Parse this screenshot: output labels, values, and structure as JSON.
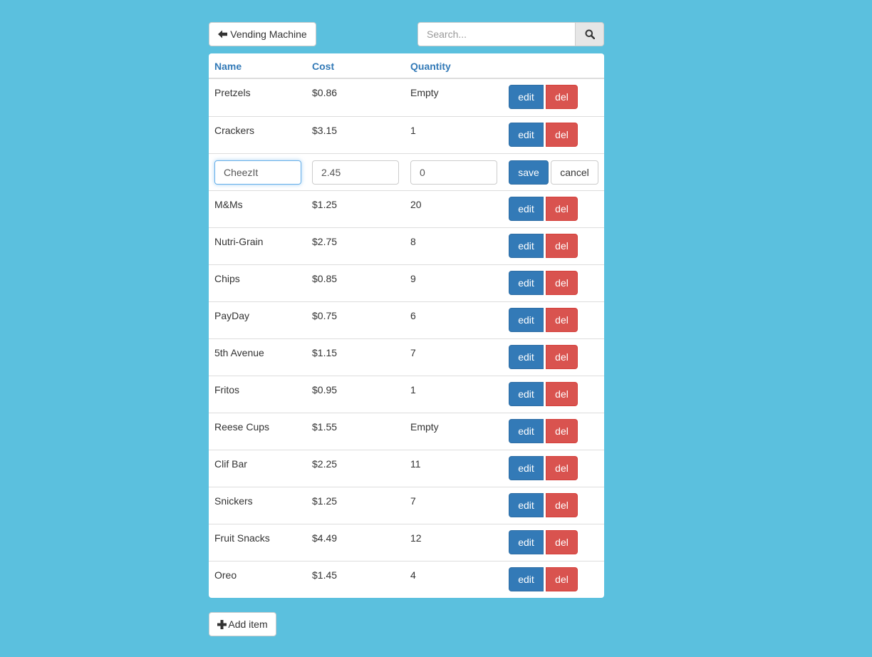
{
  "header": {
    "back_label": "Vending Machine",
    "back_icon": "arrow-left-icon",
    "search_placeholder": "Search...",
    "search_icon": "search-icon"
  },
  "table": {
    "columns": [
      "Name",
      "Cost",
      "Quantity"
    ],
    "rows": [
      {
        "name": "Pretzels",
        "cost": "$0.86",
        "quantity": "Empty"
      },
      {
        "name": "Crackers",
        "cost": "$3.15",
        "quantity": "1"
      },
      {
        "editing": true,
        "name": "CheezIt",
        "cost": "2.45",
        "quantity": "0"
      },
      {
        "name": "M&Ms",
        "cost": "$1.25",
        "quantity": "20"
      },
      {
        "name": "Nutri-Grain",
        "cost": "$2.75",
        "quantity": "8"
      },
      {
        "name": "Chips",
        "cost": "$0.85",
        "quantity": "9"
      },
      {
        "name": "PayDay",
        "cost": "$0.75",
        "quantity": "6"
      },
      {
        "name": "5th Avenue",
        "cost": "$1.15",
        "quantity": "7"
      },
      {
        "name": "Fritos",
        "cost": "$0.95",
        "quantity": "1"
      },
      {
        "name": "Reese Cups",
        "cost": "$1.55",
        "quantity": "Empty"
      },
      {
        "name": "Clif Bar",
        "cost": "$2.25",
        "quantity": "11"
      },
      {
        "name": "Snickers",
        "cost": "$1.25",
        "quantity": "7"
      },
      {
        "name": "Fruit Snacks",
        "cost": "$4.49",
        "quantity": "12"
      },
      {
        "name": "Oreo",
        "cost": "$1.45",
        "quantity": "4"
      }
    ],
    "edit_label": "edit",
    "del_label": "del",
    "save_label": "save",
    "cancel_label": "cancel"
  },
  "footer": {
    "add_label": "Add item",
    "add_icon": "plus-icon"
  },
  "colors": {
    "background": "#5bc0de",
    "primary": "#337ab7",
    "danger": "#d9534f"
  }
}
